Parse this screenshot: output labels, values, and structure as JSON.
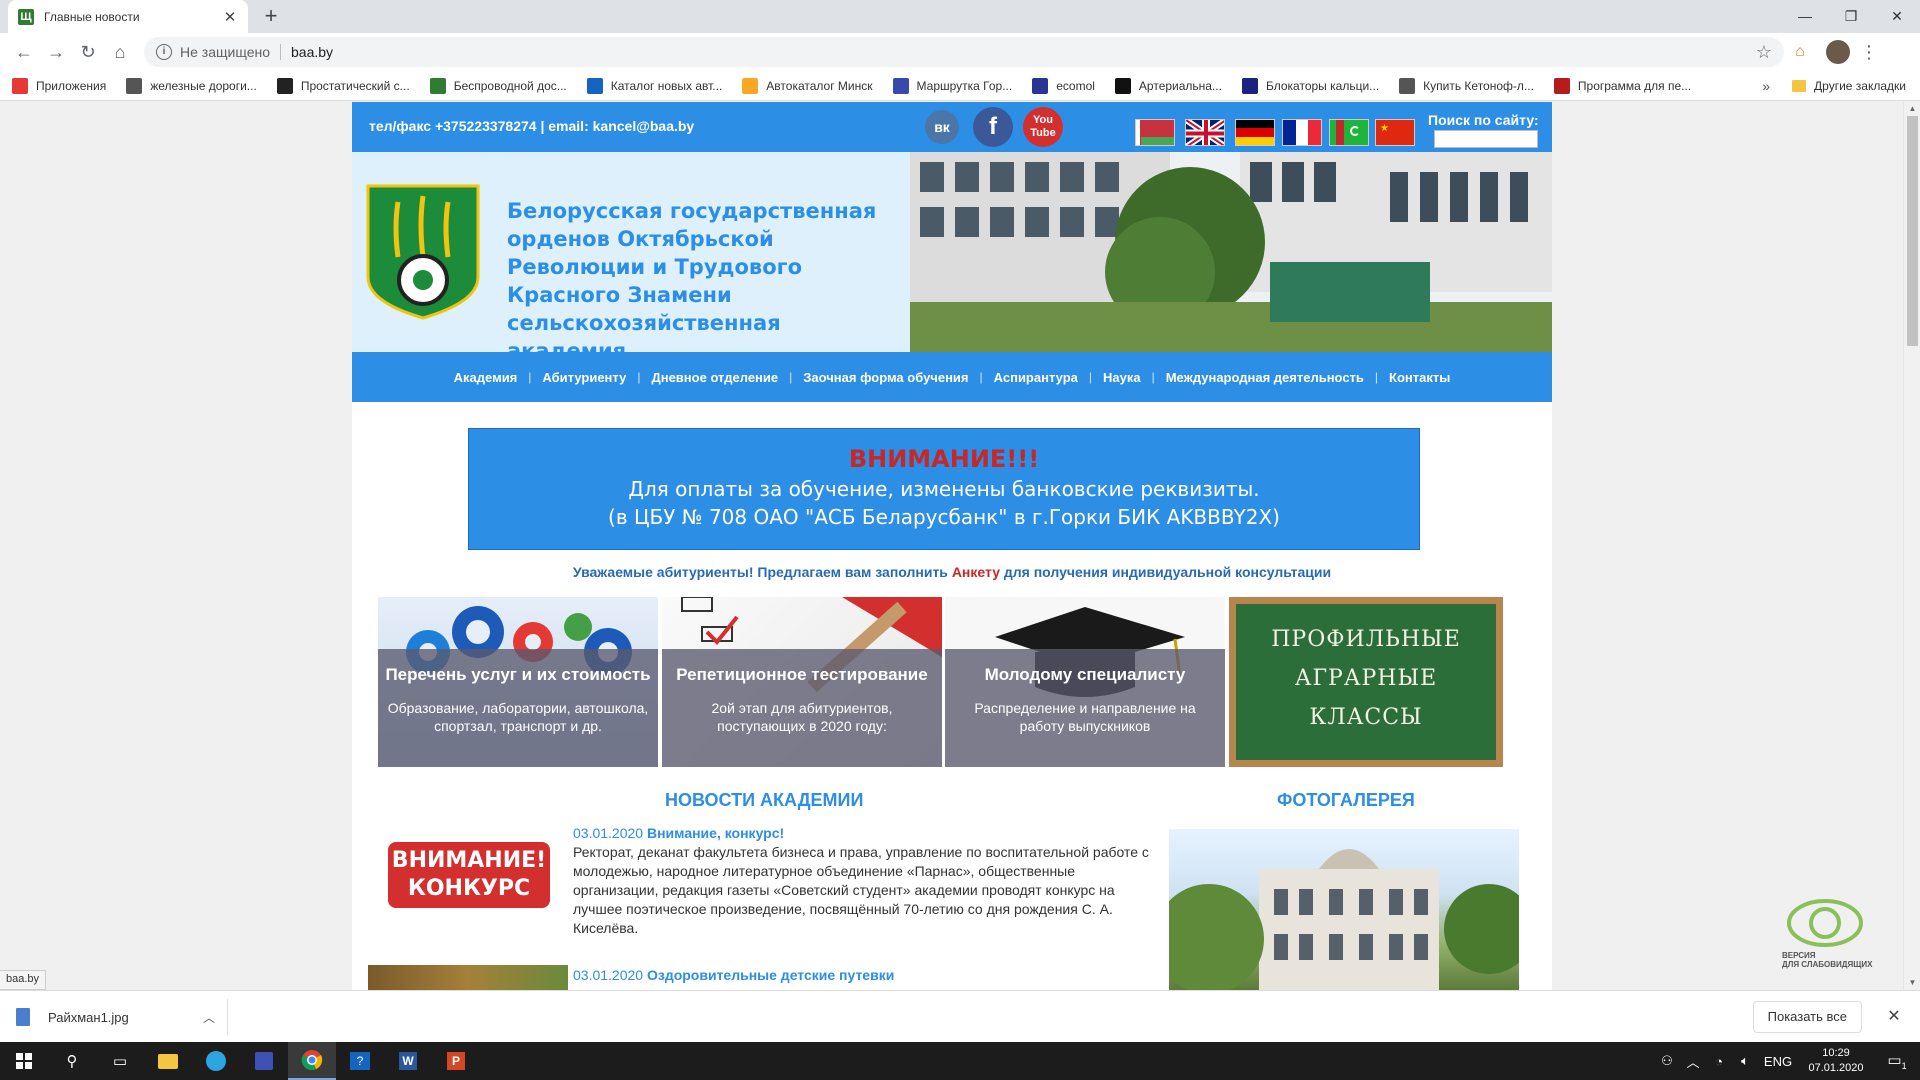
{
  "browser": {
    "tab_title": "Главные новости",
    "tab_favicon": "Щ",
    "security_label": "Не защищено",
    "url": "baa.by",
    "bookmarks": [
      {
        "label": "Приложения",
        "icon": "apps-grid-icon",
        "color": "#e53935"
      },
      {
        "label": "железные дороги...",
        "icon": "globe-icon",
        "color": "#555555"
      },
      {
        "label": "Простатический с...",
        "icon": "wikipedia-icon",
        "color": "#222222"
      },
      {
        "label": "Беспроводной дос...",
        "icon": "feather-icon",
        "color": "#2e7d32"
      },
      {
        "label": "Каталог новых авт...",
        "icon": "catalog-icon",
        "color": "#1565c0"
      },
      {
        "label": "Автокаталог Минск",
        "icon": "ak-icon",
        "color": "#f9a825"
      },
      {
        "label": "Маршрутка Гор...",
        "icon": "bus-icon",
        "color": "#3949ab"
      },
      {
        "label": "ecomol",
        "icon": "ecomol-icon",
        "color": "#283593"
      },
      {
        "label": "Артериальна...",
        "icon": "vx-icon",
        "color": "#111111"
      },
      {
        "label": "Блокаторы кальци...",
        "icon": "building-icon",
        "color": "#1a237e"
      },
      {
        "label": "Купить Кетоноф-л...",
        "icon": "globe-icon",
        "color": "#555555"
      },
      {
        "label": "Программа для пе...",
        "icon": "lf-icon",
        "color": "#b71c1c"
      }
    ],
    "more_bookmarks": "»",
    "other_bookmarks": "Другие закладки",
    "status_url": "baa.by"
  },
  "site": {
    "contact": "тел/факс +375223378274 | email: kancel@baa.by",
    "search_label": "Поиск по сайту:",
    "social": {
      "vk": "вк",
      "fb": "f",
      "yt": "You Tube"
    },
    "org_name": "Белорусская государственная орденов Октябрьской Революции и Трудового Красного Знамени сельскохозяйственная академия",
    "nav": [
      "Академия",
      "Абитуриенту",
      "Дневное отделение",
      "Заочная форма обучения",
      "Аспирантура",
      "Наука",
      "Международная деятельность",
      "Контакты"
    ],
    "notice": {
      "warning": "ВНИМАНИЕ!!!",
      "line1": "Для оплаты за обучение, изменены банковские реквизиты.",
      "line2": "(в ЦБУ № 708 ОАО \"АСБ Беларусбанк\" в г.Горки БИК AKBBBY2X)"
    },
    "invite": {
      "prefix": "Уважаемые абитуриенты! Предлагаем вам заполнить ",
      "link": "Анкету",
      "suffix": " для получения индивидуальной консультации"
    },
    "cards": [
      {
        "title": "Перечень услуг и их стоимость",
        "desc": "Образование, лаборатории, автошкола, спортзал, транспорт и др."
      },
      {
        "title": "Репетиционное тестирование",
        "desc": "2ой этап для абитуриентов, поступающих в 2020 году:"
      },
      {
        "title": "Молодому специалисту",
        "desc": "Распределение и направление на работу выпускников"
      }
    ],
    "board_lines": [
      "ПРОФИЛЬНЫЕ",
      "АГРАРНЫЕ",
      "КЛАССЫ"
    ],
    "news_heading": "НОВОСТИ АКАДЕМИИ",
    "gallery_heading": "ФОТОГАЛЕРЕЯ",
    "news": [
      {
        "date": "03.01.2020",
        "title": "Внимание, конкурс!",
        "text": "Ректорат, деканат факультета бизнеса и права, управление по воспитательной работе с молодежью, народное литературное объединение «Парнас», общественные организации, редакция газеты «Советский студент» академии проводят конкурс на лучшее поэтическое произведение, посвящённый 70-летию со дня рождения С. А. Киселёва."
      },
      {
        "date": "03.01.2020",
        "title": "Оздоровительные детские путевки",
        "text": ""
      }
    ],
    "news_thumb_lines": [
      "ВНИМАНИЕ!",
      "КОНКУРС"
    ],
    "lowvision": [
      "ВЕРСИЯ",
      "ДЛЯ СЛАБОВИДЯЩИХ"
    ]
  },
  "downloads": {
    "file": "Райхман1.jpg",
    "show_all": "Показать все"
  },
  "taskbar": {
    "lang": "ENG",
    "time": "10:29",
    "date": "07.01.2020",
    "notif_count": "1"
  }
}
